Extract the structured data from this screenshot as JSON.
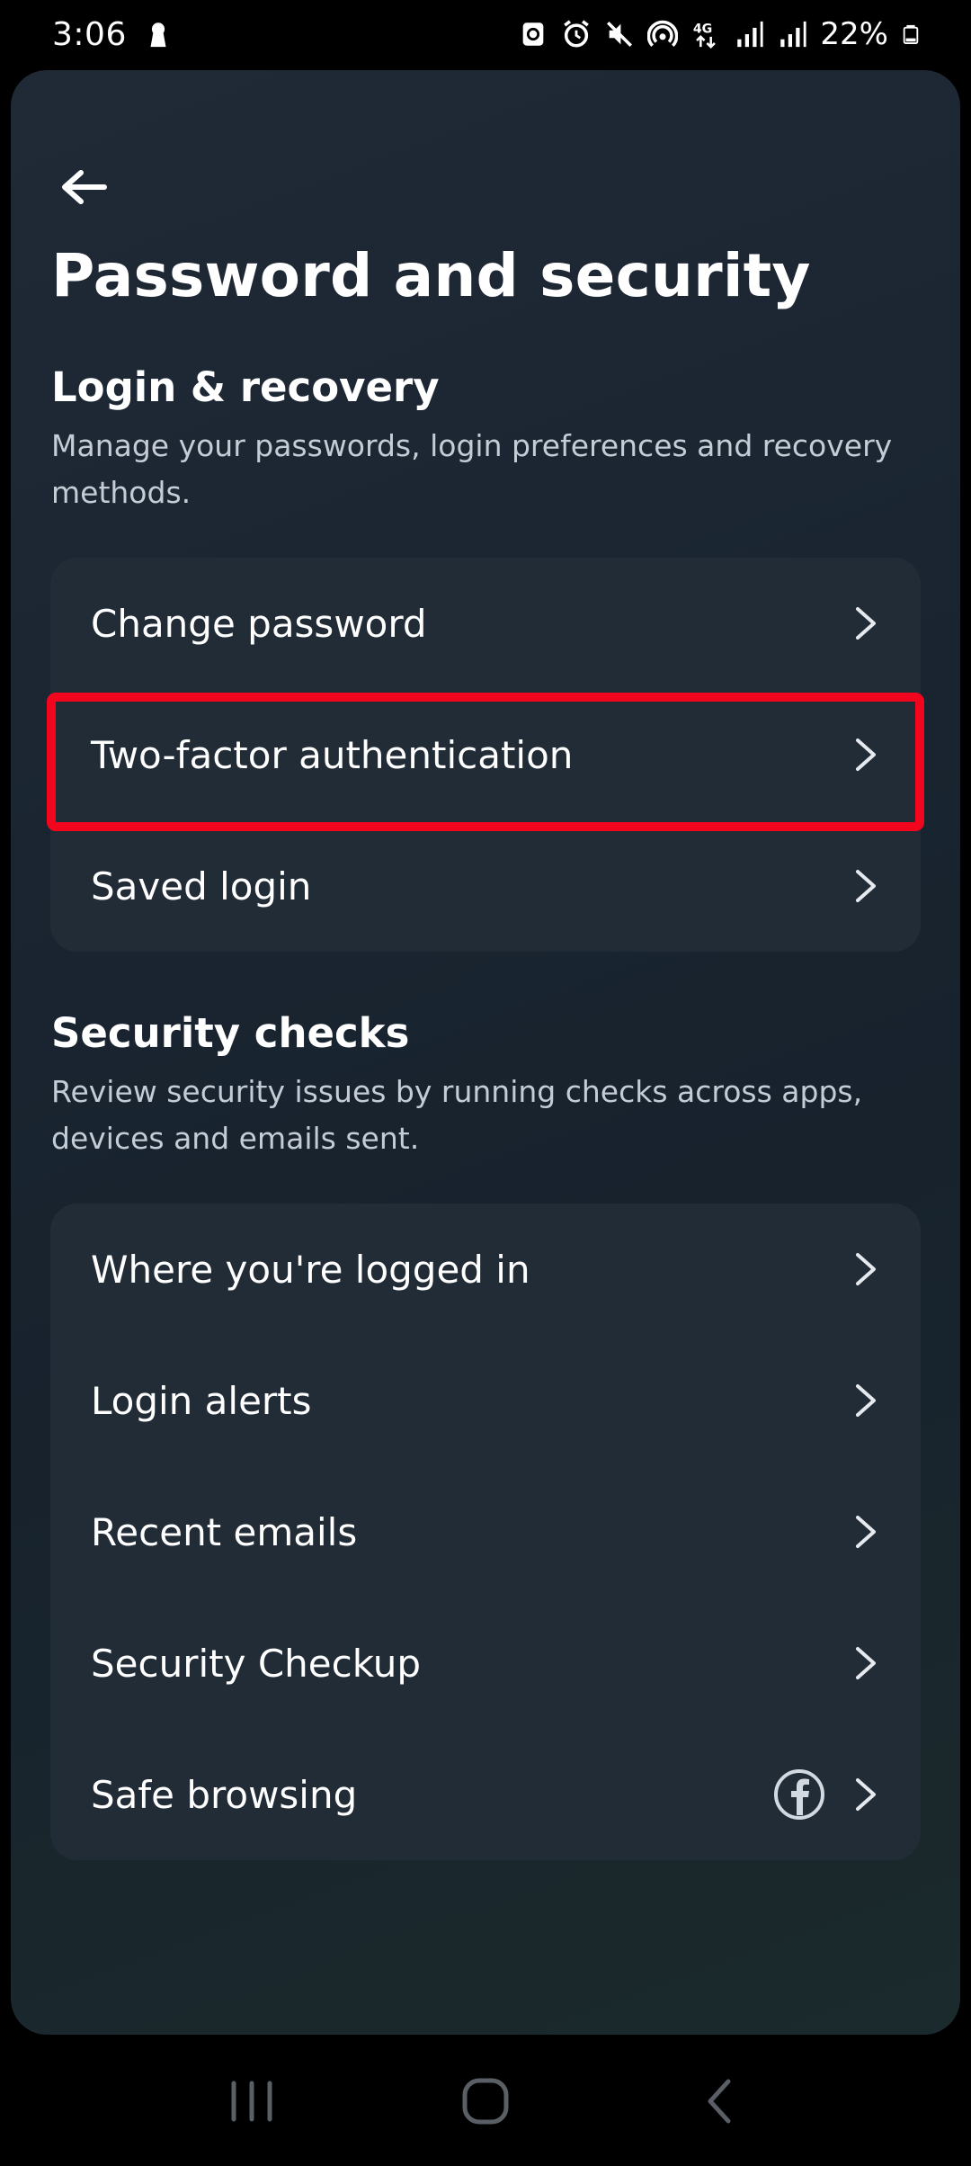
{
  "status_bar": {
    "time": "3:06",
    "battery": "22%",
    "icons": [
      "keyhole-icon",
      "sync-icon",
      "alarm-icon",
      "mute-icon",
      "hotspot-icon",
      "4g-icon",
      "signal-icon",
      "signal-icon",
      "battery-icon"
    ]
  },
  "header": {
    "back_icon": "arrow-left-icon",
    "title": "Password and security"
  },
  "login_section": {
    "title": "Login & recovery",
    "description": "Manage your passwords, login preferences and recovery methods.",
    "items": [
      {
        "label": "Change password"
      },
      {
        "label": "Two-factor authentication"
      },
      {
        "label": "Saved login"
      }
    ]
  },
  "security_section": {
    "title": "Security checks",
    "description": "Review security issues by running checks across apps, devices and emails sent.",
    "items": [
      {
        "label": "Where you're logged in"
      },
      {
        "label": "Login alerts"
      },
      {
        "label": "Recent emails"
      },
      {
        "label": "Security Checkup"
      },
      {
        "label": "Safe browsing",
        "badge_icon": "facebook-icon"
      }
    ]
  },
  "nav_bar": {
    "icons": [
      "recents-icon",
      "home-icon",
      "back-icon"
    ]
  },
  "colors": {
    "highlight": "#f1061d",
    "card": "#212c37",
    "text_secondary": "#c4ccd6"
  }
}
